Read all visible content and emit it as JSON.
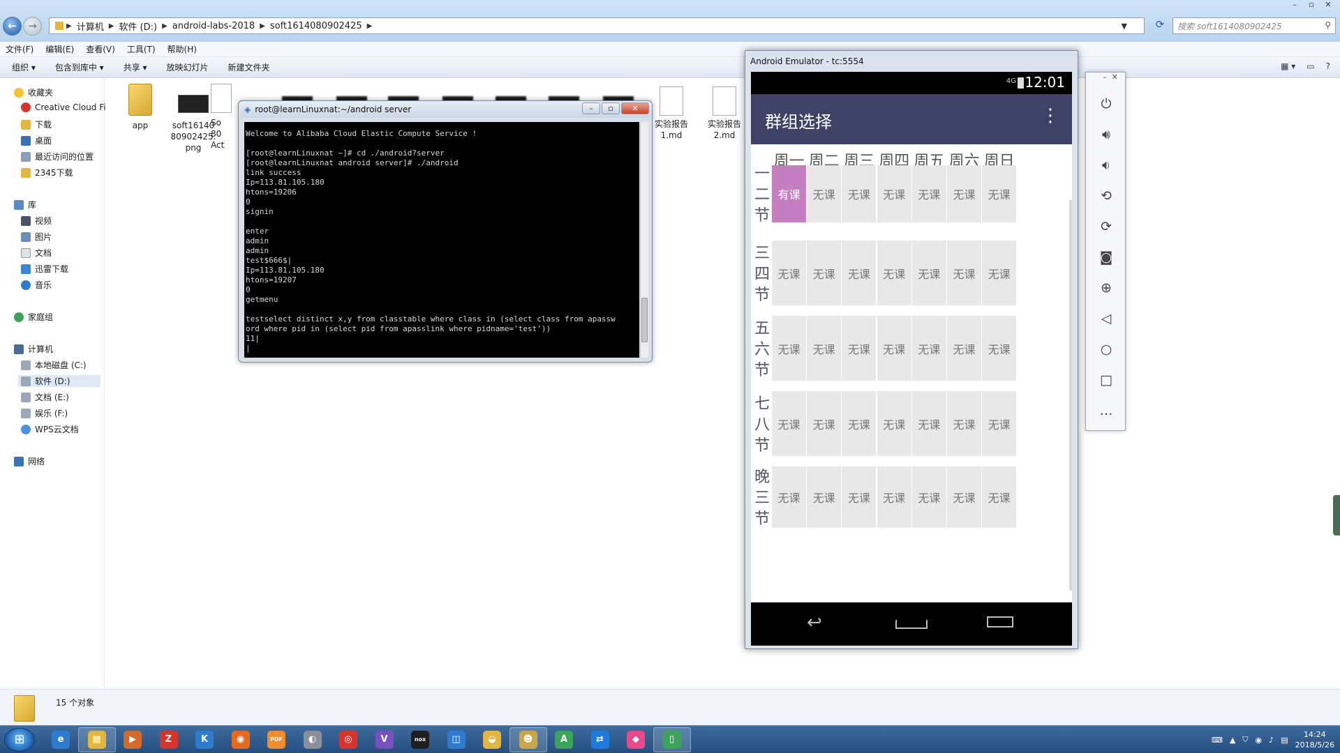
{
  "explorer": {
    "breadcrumb": [
      "计算机",
      "软件 (D:)",
      "android-labs-2018",
      "soft1614080902425"
    ],
    "search_placeholder": "搜索 soft1614080902425",
    "menu": [
      "文件(F)",
      "编辑(E)",
      "查看(V)",
      "工具(T)",
      "帮助(H)"
    ],
    "commands": [
      "组织 ▾",
      "包含到库中 ▾",
      "共享 ▾",
      "放映幻灯片",
      "新建文件夹"
    ],
    "nav": {
      "favorites": "收藏夹",
      "fav_items": [
        "Creative Cloud Fi",
        "下载",
        "桌面",
        "最近访问的位置",
        "2345下载"
      ],
      "libraries": "库",
      "lib_items": [
        "视频",
        "图片",
        "文档",
        "迅雷下载",
        "音乐"
      ],
      "homegroup": "家庭组",
      "computer": "计算机",
      "drives": [
        "本地磁盘 (C:)",
        "软件 (D:)",
        "文档 (E:)",
        "娱乐 (F:)",
        "WPS云文档"
      ],
      "network": "网络"
    },
    "files": [
      {
        "name": "app",
        "type": "folder"
      },
      {
        "name": "soft16140\n80902425.\npng",
        "type": "image"
      },
      {
        "name": "So\n80\nAct",
        "type": "partial"
      },
      {
        "name": "实验报告\n1.md",
        "type": "doc"
      },
      {
        "name": "实验报告\n2.md",
        "type": "doc"
      }
    ],
    "status": "15 个对象"
  },
  "terminal": {
    "title": "root@learnLinuxnat:~/android server",
    "lines": "Welcome to Alibaba Cloud Elastic Compute Service !\n\n[root@learnLinuxnat ~]# cd ./android?server\n[root@learnLinuxnat android server]# ./android\nlink success\nIp=113.81.105.180\nhtons=19206\n0\nsignin\n\nenter\nadmin\nadmin\ntest$666$|\nIp=113.81.105.180\nhtons=19207\n0\ngetmenu\n\ntestselect distinct x,y from classtable where class in (select class from apassw\nord where pid in (select pid from apasslink where pidname='test'))\n11|\n|"
  },
  "emulator": {
    "title": "Android Emulator - tc:5554",
    "status_time": "12:01",
    "signal": "4G",
    "app_title": "群组选择",
    "days": [
      "周一",
      "周二",
      "周三",
      "周四",
      "周五",
      "周六",
      "周日"
    ],
    "periods": [
      "一\n二\n节",
      "三\n四\n节",
      "五\n六\n节",
      "七\n八\n节",
      "晚\n三\n节"
    ],
    "cells": [
      [
        "有课",
        "无课",
        "无课",
        "无课",
        "无课",
        "无课",
        "无课"
      ],
      [
        "无课",
        "无课",
        "无课",
        "无课",
        "无课",
        "无课",
        "无课"
      ],
      [
        "无课",
        "无课",
        "无课",
        "无课",
        "无课",
        "无课",
        "无课"
      ],
      [
        "无课",
        "无课",
        "无课",
        "无课",
        "无课",
        "无课",
        "无课"
      ],
      [
        "无课",
        "无课",
        "无课",
        "无课",
        "无课",
        "无课",
        "无课"
      ]
    ],
    "has_class_color": "#c47fc1",
    "appbar_color": "#3d4266",
    "tools": [
      "power-icon",
      "volume-up-icon",
      "volume-down-icon",
      "rotate-left-icon",
      "rotate-right-icon",
      "camera-icon",
      "zoom-icon",
      "back-icon",
      "home-icon",
      "overview-icon",
      "more-icon"
    ]
  },
  "taskbar": {
    "time": "14:24",
    "date": "2018/5/26",
    "apps": [
      "ie-icon",
      "explorer-icon",
      "media-icon",
      "pdf-icon",
      "k-icon",
      "firefox-icon",
      "pdf2-icon",
      "qq-icon",
      "netease-music-icon",
      "vs-icon",
      "nox-icon",
      "screen-icon",
      "bird-icon",
      "game-icon",
      "android-studio-icon",
      "teamviewer-icon",
      "tool-icon",
      "emulator-icon"
    ]
  }
}
